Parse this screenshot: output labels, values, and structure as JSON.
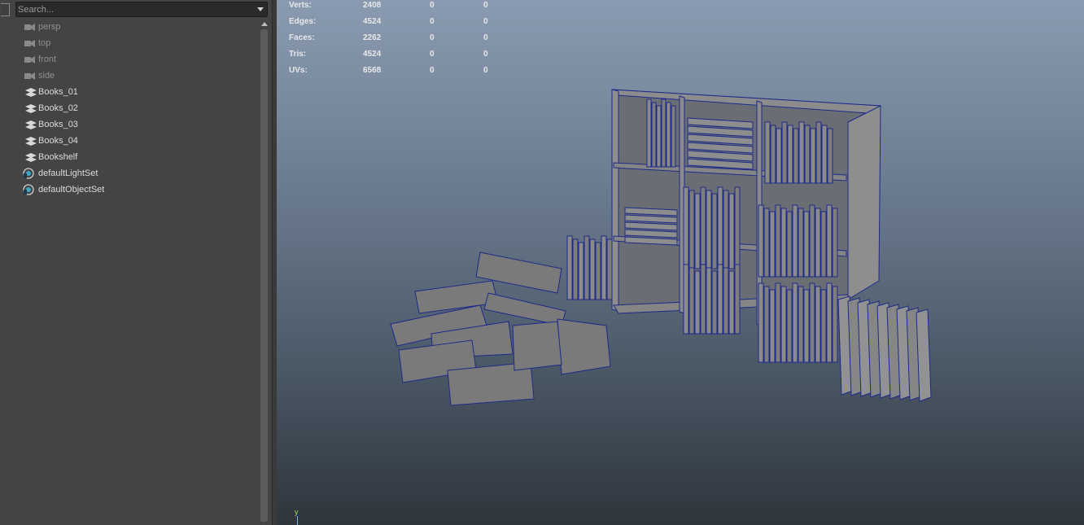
{
  "outliner": {
    "search": {
      "placeholder": "Search..."
    },
    "items": [
      {
        "label": "persp",
        "kind": "camera",
        "icon": "camera-icon"
      },
      {
        "label": "top",
        "kind": "camera",
        "icon": "camera-icon"
      },
      {
        "label": "front",
        "kind": "camera",
        "icon": "camera-icon"
      },
      {
        "label": "side",
        "kind": "camera",
        "icon": "camera-icon"
      },
      {
        "label": "Books_01",
        "kind": "mesh",
        "icon": "mesh-icon"
      },
      {
        "label": "Books_02",
        "kind": "mesh",
        "icon": "mesh-icon"
      },
      {
        "label": "Books_03",
        "kind": "mesh",
        "icon": "mesh-icon"
      },
      {
        "label": "Books_04",
        "kind": "mesh",
        "icon": "mesh-icon"
      },
      {
        "label": "Bookshelf",
        "kind": "mesh",
        "icon": "mesh-icon"
      },
      {
        "label": "defaultLightSet",
        "kind": "set",
        "icon": "set-icon"
      },
      {
        "label": "defaultObjectSet",
        "kind": "set",
        "icon": "set-icon"
      }
    ]
  },
  "hud": {
    "rows": [
      {
        "key": "Verts:",
        "v1": "2408",
        "v2": "0",
        "v3": "0"
      },
      {
        "key": "Edges:",
        "v1": "4524",
        "v2": "0",
        "v3": "0"
      },
      {
        "key": "Faces:",
        "v1": "2262",
        "v2": "0",
        "v3": "0"
      },
      {
        "key": "Tris:",
        "v1": "4524",
        "v2": "0",
        "v3": "0"
      },
      {
        "key": "UVs:",
        "v1": "6568",
        "v2": "0",
        "v3": "0"
      }
    ]
  },
  "viewport": {
    "axis_label": "y"
  },
  "colors": {
    "wireframe": "#1d2a8a",
    "shaded": "#7a7a7a",
    "set_icon": "#3fa8c7"
  }
}
